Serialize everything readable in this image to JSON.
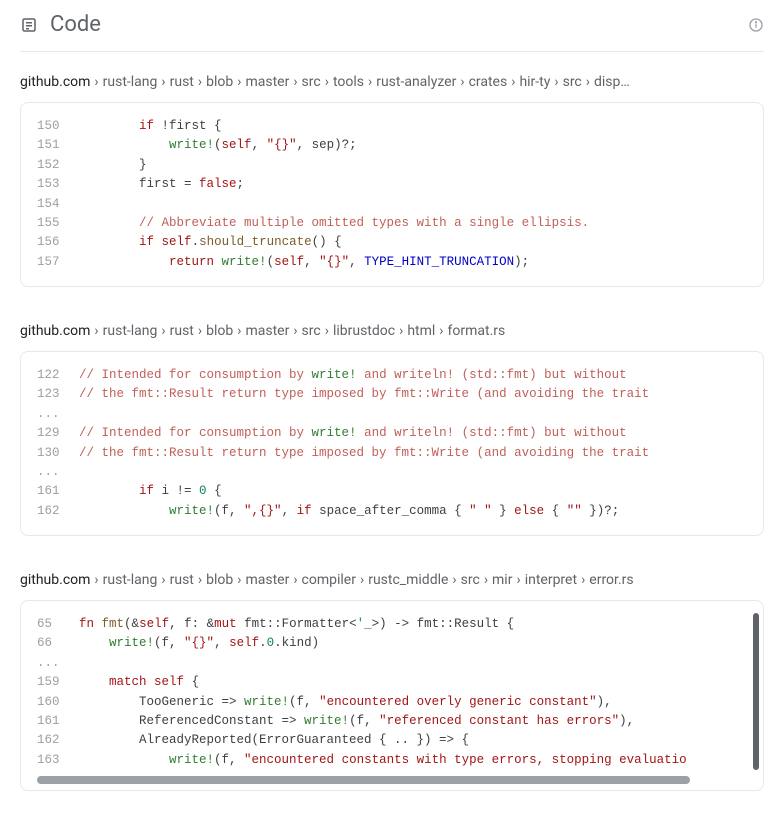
{
  "header": {
    "title": "Code"
  },
  "results": [
    {
      "breadcrumb": {
        "domain": "github.com",
        "path": [
          "rust-lang",
          "rust",
          "blob",
          "master",
          "src",
          "tools",
          "rust-analyzer",
          "crates",
          "hir-ty",
          "src",
          "disp…"
        ]
      },
      "lines": [
        {
          "ln": "150",
          "tokens": [
            [
              "",
              "        "
            ],
            [
              "kw",
              "if"
            ],
            [
              "",
              " !first {"
            ]
          ]
        },
        {
          "ln": "151",
          "tokens": [
            [
              "",
              "            "
            ],
            [
              "macro",
              "write!"
            ],
            [
              "",
              "("
            ],
            [
              "kw",
              "self"
            ],
            [
              "",
              ", "
            ],
            [
              "str",
              "\"{}\""
            ],
            [
              "",
              ", sep)?;"
            ]
          ]
        },
        {
          "ln": "152",
          "tokens": [
            [
              "",
              "        }"
            ]
          ]
        },
        {
          "ln": "153",
          "tokens": [
            [
              "",
              "        first = "
            ],
            [
              "kw",
              "false"
            ],
            [
              "",
              ";"
            ]
          ]
        },
        {
          "ln": "154",
          "tokens": [
            [
              "",
              ""
            ]
          ]
        },
        {
          "ln": "155",
          "tokens": [
            [
              "",
              "        "
            ],
            [
              "comm",
              "// Abbreviate multiple omitted types with a single ellipsis."
            ]
          ]
        },
        {
          "ln": "156",
          "tokens": [
            [
              "",
              "        "
            ],
            [
              "kw",
              "if"
            ],
            [
              "",
              " "
            ],
            [
              "kw",
              "self"
            ],
            [
              "",
              "."
            ],
            [
              "fn",
              "should_truncate"
            ],
            [
              "",
              "() {"
            ]
          ]
        },
        {
          "ln": "157",
          "tokens": [
            [
              "",
              "            "
            ],
            [
              "kw",
              "return"
            ],
            [
              "",
              " "
            ],
            [
              "macro",
              "write!"
            ],
            [
              "",
              "("
            ],
            [
              "kw",
              "self"
            ],
            [
              "",
              ", "
            ],
            [
              "str",
              "\"{}\""
            ],
            [
              "",
              ", "
            ],
            [
              "const",
              "TYPE_HINT_TRUNCATION"
            ],
            [
              "",
              ");"
            ]
          ]
        }
      ]
    },
    {
      "breadcrumb": {
        "domain": "github.com",
        "path": [
          "rust-lang",
          "rust",
          "blob",
          "master",
          "src",
          "librustdoc",
          "html",
          "format.rs"
        ]
      },
      "lines": [
        {
          "ln": "122",
          "tokens": [
            [
              "comm",
              "// Intended for consumption by "
            ],
            [
              "macro",
              "write!"
            ],
            [
              "comm",
              " and writeln! (std::fmt) but without"
            ]
          ]
        },
        {
          "ln": "123",
          "tokens": [
            [
              "comm",
              "// the fmt::Result return type imposed by fmt::Write (and avoiding the trait"
            ]
          ]
        },
        {
          "ln": "...",
          "tokens": [
            [
              "",
              ""
            ]
          ]
        },
        {
          "ln": "129",
          "tokens": [
            [
              "comm",
              "// Intended for consumption by "
            ],
            [
              "macro",
              "write!"
            ],
            [
              "comm",
              " and writeln! (std::fmt) but without"
            ]
          ]
        },
        {
          "ln": "130",
          "tokens": [
            [
              "comm",
              "// the fmt::Result return type imposed by fmt::Write (and avoiding the trait"
            ]
          ]
        },
        {
          "ln": "...",
          "tokens": [
            [
              "",
              ""
            ]
          ]
        },
        {
          "ln": "161",
          "tokens": [
            [
              "",
              "        "
            ],
            [
              "kw",
              "if"
            ],
            [
              "",
              " i != "
            ],
            [
              "lit",
              "0"
            ],
            [
              "",
              " {"
            ]
          ]
        },
        {
          "ln": "162",
          "tokens": [
            [
              "",
              "            "
            ],
            [
              "macro",
              "write!"
            ],
            [
              "",
              "(f, "
            ],
            [
              "str",
              "\",{}\""
            ],
            [
              "",
              ", "
            ],
            [
              "kw",
              "if"
            ],
            [
              "",
              " space_after_comma { "
            ],
            [
              "str",
              "\" \""
            ],
            [
              "",
              " } "
            ],
            [
              "kw",
              "else"
            ],
            [
              "",
              " { "
            ],
            [
              "str",
              "\"\""
            ],
            [
              "",
              " })?;"
            ]
          ]
        }
      ]
    },
    {
      "breadcrumb": {
        "domain": "github.com",
        "path": [
          "rust-lang",
          "rust",
          "blob",
          "master",
          "compiler",
          "rustc_middle",
          "src",
          "mir",
          "interpret",
          "error.rs"
        ]
      },
      "scroll": true,
      "lines": [
        {
          "ln": "65",
          "tokens": [
            [
              "kw",
              "fn"
            ],
            [
              "",
              " "
            ],
            [
              "fn",
              "fmt"
            ],
            [
              "",
              "(&"
            ],
            [
              "kw",
              "self"
            ],
            [
              "",
              ", f: &"
            ],
            [
              "kw",
              "mut"
            ],
            [
              "",
              " fmt::Formatter<"
            ],
            [
              "type",
              "'_"
            ],
            [
              "",
              ">) -> fmt::Result {"
            ]
          ]
        },
        {
          "ln": "66",
          "tokens": [
            [
              "",
              "    "
            ],
            [
              "macro",
              "write!"
            ],
            [
              "",
              "(f, "
            ],
            [
              "str",
              "\"{}\""
            ],
            [
              "",
              ", "
            ],
            [
              "kw",
              "self"
            ],
            [
              "",
              "."
            ],
            [
              "lit",
              "0"
            ],
            [
              "",
              ".kind)"
            ]
          ]
        },
        {
          "ln": "...",
          "tokens": [
            [
              "",
              ""
            ]
          ]
        },
        {
          "ln": "159",
          "tokens": [
            [
              "",
              "    "
            ],
            [
              "kw",
              "match"
            ],
            [
              "",
              " "
            ],
            [
              "kw",
              "self"
            ],
            [
              "",
              " {"
            ]
          ]
        },
        {
          "ln": "160",
          "tokens": [
            [
              "",
              "        TooGeneric => "
            ],
            [
              "macro",
              "write!"
            ],
            [
              "",
              "(f, "
            ],
            [
              "str",
              "\"encountered overly generic constant\""
            ],
            [
              "",
              "),"
            ]
          ]
        },
        {
          "ln": "161",
          "tokens": [
            [
              "",
              "        ReferencedConstant => "
            ],
            [
              "macro",
              "write!"
            ],
            [
              "",
              "(f, "
            ],
            [
              "str",
              "\"referenced constant has errors\""
            ],
            [
              "",
              "),"
            ]
          ]
        },
        {
          "ln": "162",
          "tokens": [
            [
              "",
              "        AlreadyReported(ErrorGuaranteed { .. }) => {"
            ]
          ]
        },
        {
          "ln": "163",
          "tokens": [
            [
              "",
              "            "
            ],
            [
              "macro",
              "write!"
            ],
            [
              "",
              "(f, "
            ],
            [
              "str",
              "\"encountered constants with type errors, stopping evaluatio"
            ]
          ]
        }
      ]
    }
  ]
}
